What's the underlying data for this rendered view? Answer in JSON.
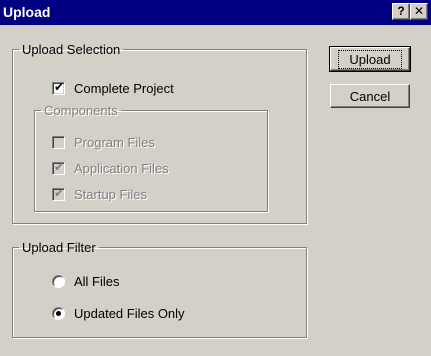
{
  "window": {
    "title": "Upload",
    "help_label": "?",
    "close_label": "✕"
  },
  "upload_selection": {
    "legend": "Upload Selection",
    "complete_project": {
      "label": "Complete Project",
      "checked": true
    },
    "components": {
      "legend": "Components",
      "items": [
        {
          "label": "Program Files",
          "checked": false,
          "enabled": false
        },
        {
          "label": "Application Files",
          "checked": true,
          "enabled": false
        },
        {
          "label": "Startup Files",
          "checked": true,
          "enabled": false
        }
      ]
    }
  },
  "upload_filter": {
    "legend": "Upload Filter",
    "options": [
      {
        "label": "All Files",
        "selected": false
      },
      {
        "label": "Updated Files Only",
        "selected": true
      }
    ]
  },
  "buttons": {
    "upload_label": "Upload",
    "cancel_label": "Cancel"
  },
  "marks": {
    "check": "✔"
  }
}
